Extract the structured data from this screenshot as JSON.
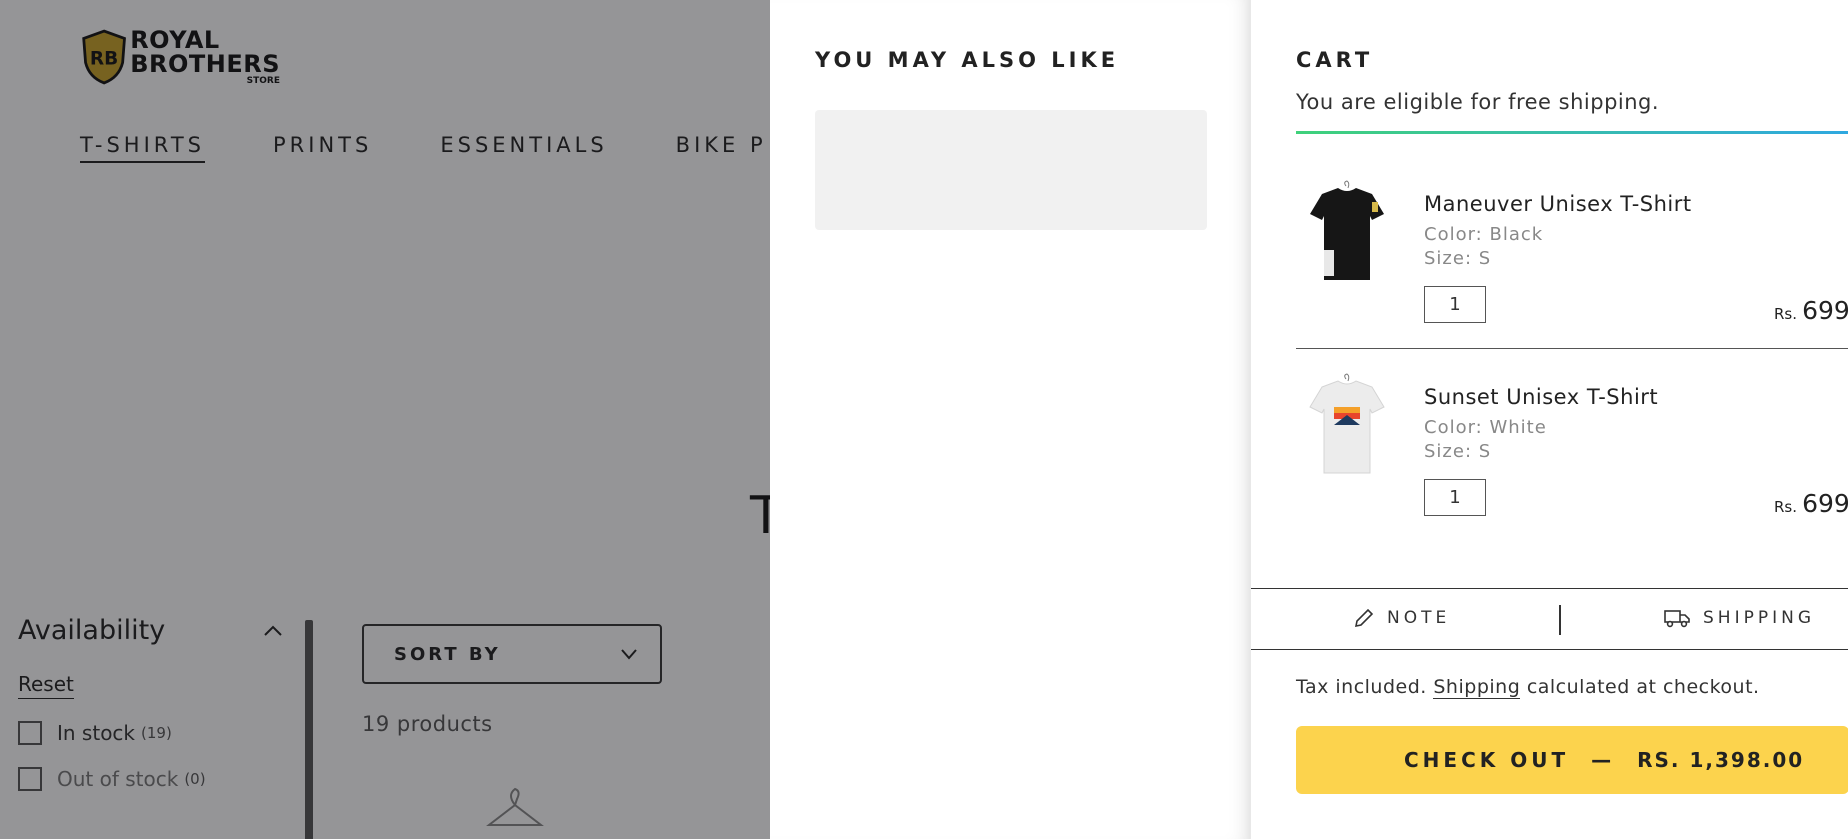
{
  "header": {
    "logo": {
      "monogram": "RB",
      "line1": "ROYAL",
      "line2": "BROTHERS",
      "line3": "STORE"
    },
    "nav": [
      {
        "label": "T-SHIRTS",
        "active": true
      },
      {
        "label": "PRINTS",
        "active": false
      },
      {
        "label": "ESSENTIALS",
        "active": false
      },
      {
        "label": "BIKE P",
        "active": false
      }
    ]
  },
  "collection": {
    "title_fragment": "T",
    "sort_label": "SORT BY",
    "product_count": "19 products"
  },
  "filters": {
    "heading": "Availability",
    "reset_label": "Reset",
    "options": [
      {
        "label": "In stock",
        "count": "(19)"
      },
      {
        "label": "Out of stock",
        "count": "(0)"
      }
    ]
  },
  "suggestions": {
    "title": "YOU MAY ALSO LIKE"
  },
  "cart": {
    "title": "CART",
    "free_shipping_message": "You are eligible for free shipping.",
    "items": [
      {
        "name": "Maneuver Unisex T-Shirt",
        "color": "Color: Black",
        "size": "Size: S",
        "quantity": "1",
        "currency": "Rs.",
        "price": "699",
        "shirt_color": "#161616"
      },
      {
        "name": "Sunset Unisex T-Shirt",
        "color": "Color: White",
        "size": "Size: S",
        "quantity": "1",
        "currency": "Rs.",
        "price": "699",
        "shirt_color": "#f2f2f2"
      }
    ],
    "note_label": "NOTE",
    "shipping_label": "SHIPPING",
    "tax_prefix": "Tax included.",
    "tax_link": "Shipping",
    "tax_suffix": "calculated at checkout.",
    "checkout_label": "CHECK OUT",
    "checkout_dash": "—",
    "checkout_total": "RS. 1,398.00"
  },
  "colors": {
    "checkout_button": "#fcd34d",
    "progress_start": "#3fd17a",
    "progress_end": "#2fa8e0",
    "overlay": "rgba(20,20,24,0.45)"
  }
}
